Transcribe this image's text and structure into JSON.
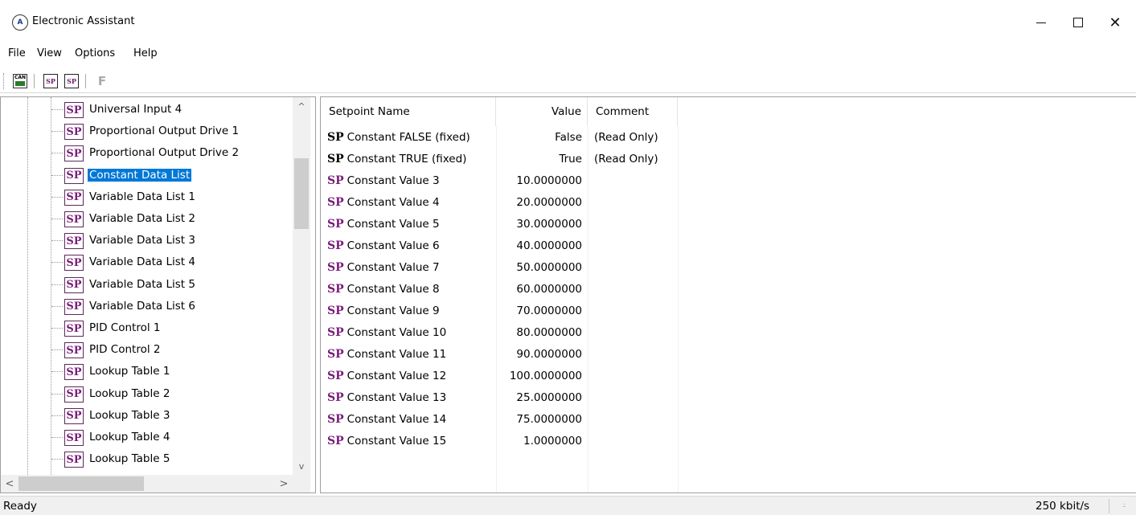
{
  "window": {
    "title": "Electronic Assistant",
    "min_label": "",
    "close_label": "✕"
  },
  "menu": [
    "File",
    "View",
    "Options",
    "Help"
  ],
  "toolbar": {
    "can_text": "CAN",
    "sp_text": "SP",
    "f_label": "F"
  },
  "tree": {
    "items": [
      {
        "label": "Universal Input 4",
        "selected": false
      },
      {
        "label": "Proportional Output Drive 1",
        "selected": false
      },
      {
        "label": "Proportional Output Drive 2",
        "selected": false
      },
      {
        "label": "Constant Data List",
        "selected": true
      },
      {
        "label": "Variable Data List 1",
        "selected": false
      },
      {
        "label": "Variable Data List 2",
        "selected": false
      },
      {
        "label": "Variable Data List 3",
        "selected": false
      },
      {
        "label": "Variable Data List 4",
        "selected": false
      },
      {
        "label": "Variable Data List 5",
        "selected": false
      },
      {
        "label": "Variable Data List 6",
        "selected": false
      },
      {
        "label": "PID Control 1",
        "selected": false
      },
      {
        "label": "PID Control 2",
        "selected": false
      },
      {
        "label": "Lookup Table 1",
        "selected": false
      },
      {
        "label": "Lookup Table 2",
        "selected": false
      },
      {
        "label": "Lookup Table 3",
        "selected": false
      },
      {
        "label": "Lookup Table 4",
        "selected": false
      },
      {
        "label": "Lookup Table 5",
        "selected": false
      }
    ],
    "icon_text": "SP",
    "scroll_up": "^",
    "scroll_down": "v",
    "scroll_left": "<",
    "scroll_right": ">"
  },
  "list": {
    "headers": {
      "name": "Setpoint Name",
      "value": "Value",
      "comment": "Comment"
    },
    "sp_prefix": "SP",
    "rows": [
      {
        "name": "Constant FALSE (fixed)",
        "value": "False",
        "comment": "(Read Only)",
        "sp_color": "black"
      },
      {
        "name": "Constant TRUE (fixed)",
        "value": "True",
        "comment": "(Read Only)",
        "sp_color": "black"
      },
      {
        "name": "Constant Value 3",
        "value": "10.0000000",
        "comment": "",
        "sp_color": "purple"
      },
      {
        "name": "Constant Value 4",
        "value": "20.0000000",
        "comment": "",
        "sp_color": "purple"
      },
      {
        "name": "Constant Value 5",
        "value": "30.0000000",
        "comment": "",
        "sp_color": "purple"
      },
      {
        "name": "Constant Value 6",
        "value": "40.0000000",
        "comment": "",
        "sp_color": "purple"
      },
      {
        "name": "Constant Value 7",
        "value": "50.0000000",
        "comment": "",
        "sp_color": "purple"
      },
      {
        "name": "Constant Value 8",
        "value": "60.0000000",
        "comment": "",
        "sp_color": "purple"
      },
      {
        "name": "Constant Value 9",
        "value": "70.0000000",
        "comment": "",
        "sp_color": "purple"
      },
      {
        "name": "Constant Value 10",
        "value": "80.0000000",
        "comment": "",
        "sp_color": "purple"
      },
      {
        "name": "Constant Value 11",
        "value": "90.0000000",
        "comment": "",
        "sp_color": "purple"
      },
      {
        "name": "Constant Value 12",
        "value": "100.0000000",
        "comment": "",
        "sp_color": "purple"
      },
      {
        "name": "Constant Value 13",
        "value": "25.0000000",
        "comment": "",
        "sp_color": "purple"
      },
      {
        "name": "Constant Value 14",
        "value": "75.0000000",
        "comment": "",
        "sp_color": "purple"
      },
      {
        "name": "Constant Value 15",
        "value": "1.0000000",
        "comment": "",
        "sp_color": "purple"
      }
    ]
  },
  "status": {
    "text": "Ready",
    "rate": "250 kbit/s",
    "grip": ".:"
  },
  "colors": {
    "selection": "#0078d7",
    "sp_purple": "#7a1c7a"
  }
}
